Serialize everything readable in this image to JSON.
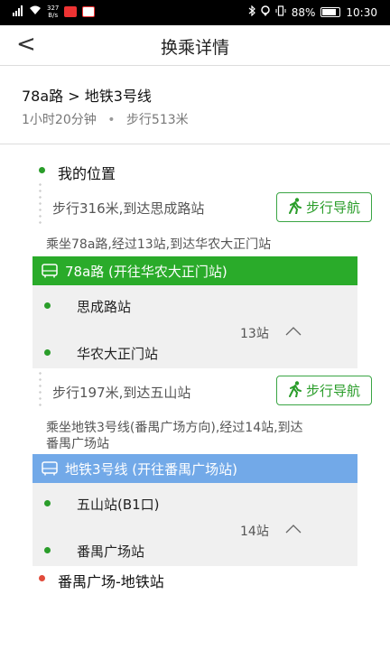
{
  "status_bar": {
    "net_speed_value": "327",
    "net_speed_unit": "B/s",
    "battery": "88%",
    "time": "10:30"
  },
  "header": {
    "back_label": "<",
    "title": "换乘详情"
  },
  "summary": {
    "route": "78a路 > 地铁3号线",
    "duration": "1小时20分钟",
    "separator": "•",
    "walk": "步行513米"
  },
  "steps": {
    "start": "我的位置",
    "walk1": "步行316米,到达思成路站",
    "nav_label": "步行导航",
    "ride1_desc": "乘坐78a路,经过13站,到达华农大正门站",
    "bus_line": {
      "label": "78a路 (开往华农大正门站)",
      "color": "#2aab2a",
      "from": "思成路站",
      "to": "华农大正门站",
      "count": "13站"
    },
    "walk2": "步行197米,到达五山站",
    "ride2_desc_line1": "乘坐地铁3号线(番禺广场方向),经过14站,到达",
    "ride2_desc_line2": "番禺广场站",
    "metro_line": {
      "label": "地铁3号线 (开往番禺广场站)",
      "color": "#72a9e8",
      "from": "五山站(B1口)",
      "to": "番禺广场站",
      "count": "14站"
    },
    "end": "番禺广场-地铁站"
  }
}
